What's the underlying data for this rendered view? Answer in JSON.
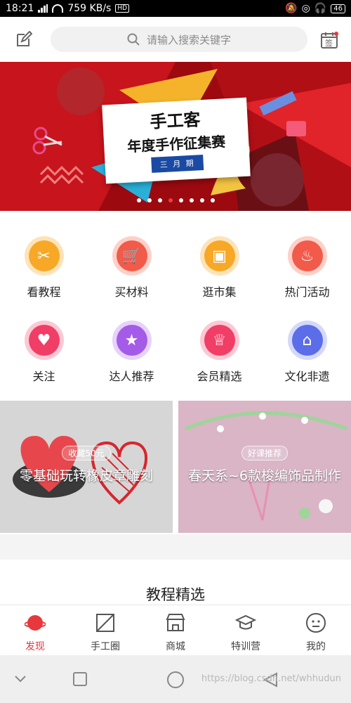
{
  "status": {
    "time": "18:21",
    "speed": "759 KB/s",
    "battery": "46"
  },
  "search": {
    "placeholder": "请输入搜索关键字"
  },
  "topbar": {
    "signin_label": "签"
  },
  "banner": {
    "title": "手工客",
    "subtitle": "年度手作征集赛",
    "tag": "三 月 期",
    "dots": 8,
    "active_dot": 3
  },
  "grid": {
    "items": [
      {
        "label": "看教程",
        "icon": "scissors-icon",
        "color": "#f7a826"
      },
      {
        "label": "买材料",
        "icon": "cart-icon",
        "color": "#f25a4a"
      },
      {
        "label": "逛市集",
        "icon": "box-icon",
        "color": "#f7a826"
      },
      {
        "label": "热门活动",
        "icon": "flame-icon",
        "color": "#f25a4a"
      },
      {
        "label": "关注",
        "icon": "heart-icon",
        "color": "#f03e66"
      },
      {
        "label": "达人推荐",
        "icon": "star-icon",
        "color": "#a45ce8"
      },
      {
        "label": "会员精选",
        "icon": "crown-icon",
        "color": "#f03e66"
      },
      {
        "label": "文化非遗",
        "icon": "building-icon",
        "color": "#5b6de8"
      }
    ]
  },
  "courses": [
    {
      "tag": "收藏50元",
      "title": "零基础玩转橡皮章雕刻"
    },
    {
      "tag": "好课推荐",
      "title": "春天系~6款梭编饰品制作"
    }
  ],
  "section": {
    "title": "教程精选"
  },
  "tabs": [
    {
      "label": "发现",
      "icon": "planet-icon",
      "active": true
    },
    {
      "label": "手工圈",
      "icon": "square-slash-icon",
      "active": false
    },
    {
      "label": "商城",
      "icon": "store-icon",
      "active": false
    },
    {
      "label": "特训营",
      "icon": "graduation-cap-icon",
      "active": false
    },
    {
      "label": "我的",
      "icon": "face-icon",
      "active": false
    }
  ],
  "watermark": "https://blog.csdn.net/whhudun"
}
